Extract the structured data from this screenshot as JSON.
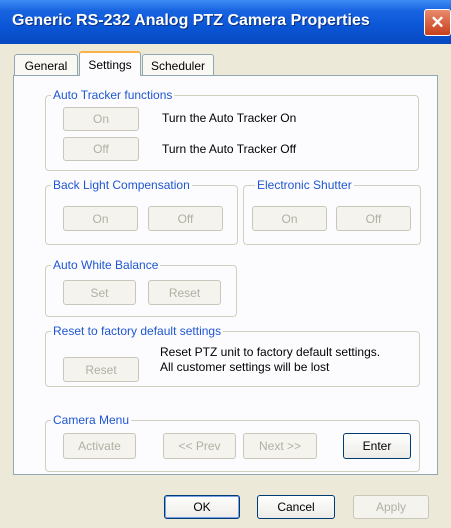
{
  "window": {
    "title": "Generic RS-232 Analog PTZ Camera Properties",
    "close_glyph": "✕"
  },
  "tabs": [
    {
      "label": "General"
    },
    {
      "label": "Settings"
    },
    {
      "label": "Scheduler"
    }
  ],
  "auto_tracker": {
    "legend": "Auto Tracker functions",
    "on_label": "On",
    "on_desc": "Turn the Auto Tracker On",
    "off_label": "Off",
    "off_desc": "Turn the Auto Tracker Off"
  },
  "backlight": {
    "legend": "Back Light Compensation",
    "on_label": "On",
    "off_label": "Off"
  },
  "shutter": {
    "legend": "Electronic Shutter",
    "on_label": "On",
    "off_label": "Off"
  },
  "white_balance": {
    "legend": "Auto White Balance",
    "set_label": "Set",
    "reset_label": "Reset"
  },
  "factory_reset": {
    "legend": "Reset to factory default settings",
    "button_label": "Reset",
    "desc_line1": "Reset PTZ unit to factory default settings.",
    "desc_line2": "All customer settings will be lost"
  },
  "camera_menu": {
    "legend": "Camera Menu",
    "activate_label": "Activate",
    "prev_label": "<< Prev",
    "next_label": "Next >>",
    "enter_label": "Enter"
  },
  "footer": {
    "ok_label": "OK",
    "cancel_label": "Cancel",
    "apply_label": "Apply"
  },
  "colors": {
    "title_bar": "#0a56d6",
    "group_legend": "#1f56d0",
    "close_button": "#c7401c",
    "tab_highlight": "#f7b24a"
  }
}
